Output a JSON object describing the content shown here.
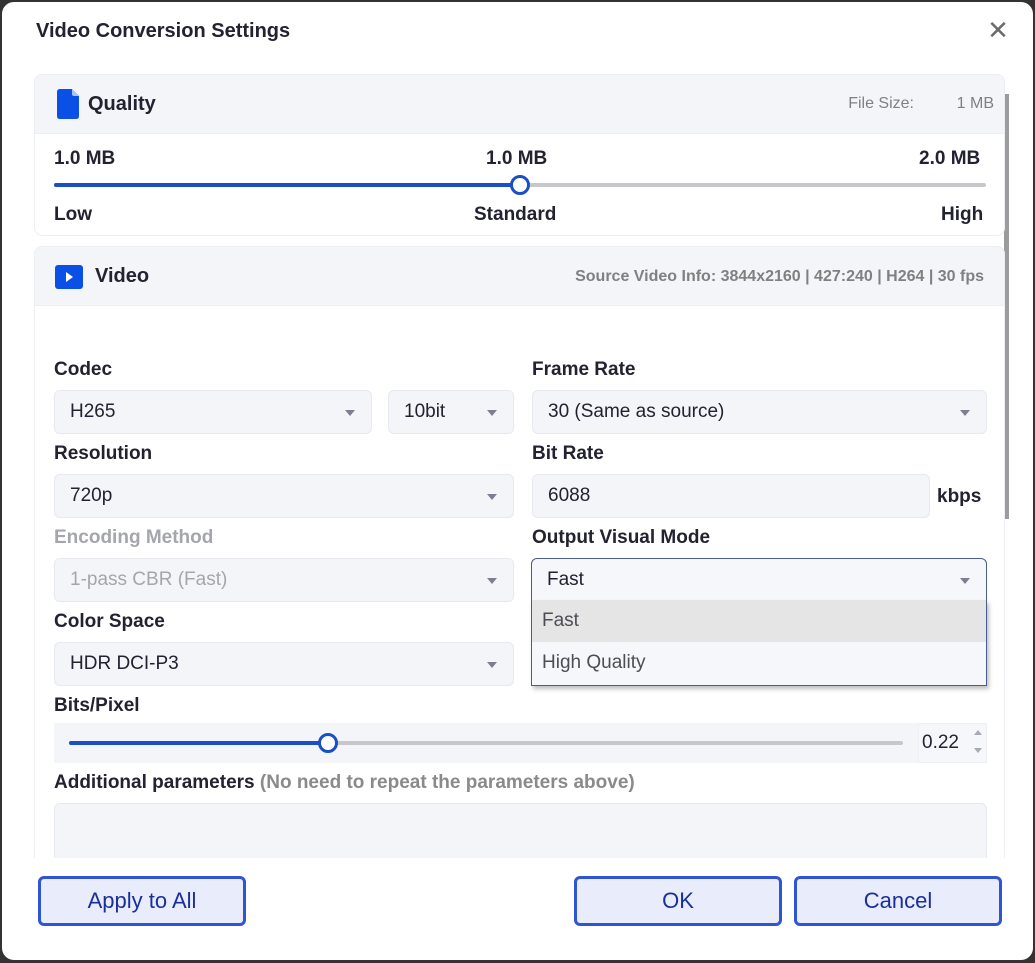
{
  "dialog": {
    "title": "Video Conversion Settings",
    "close_icon": "close-icon"
  },
  "quality": {
    "title": "Quality",
    "icon": "file-icon",
    "file_size_label": "File Size:",
    "file_size_value": "1 MB",
    "min_size": "1.0 MB",
    "mid_size": "1.0 MB",
    "max_size": "2.0 MB",
    "low_label": "Low",
    "standard_label": "Standard",
    "high_label": "High",
    "slider_value_fraction": 0.5
  },
  "video": {
    "title": "Video",
    "icon": "play-icon",
    "source_info": "Source Video Info: 3844x2160 | 427:240 | H264 | 30 fps",
    "codec_label": "Codec",
    "codec_value": "H265",
    "bit_depth_value": "10bit",
    "frame_rate_label": "Frame Rate",
    "frame_rate_value": "30 (Same as source)",
    "resolution_label": "Resolution",
    "resolution_value": "720p",
    "bit_rate_label": "Bit Rate",
    "bit_rate_value": "6088",
    "bit_rate_unit": "kbps",
    "encoding_label": "Encoding Method",
    "encoding_value": "1-pass CBR (Fast)",
    "output_mode_label": "Output Visual Mode",
    "output_mode_value": "Fast",
    "output_mode_options": [
      "Fast",
      "High Quality"
    ],
    "color_space_label": "Color Space",
    "color_space_value": "HDR DCI-P3",
    "bpp_label": "Bits/Pixel",
    "bpp_value": "0.22",
    "bpp_slider_fraction": 0.31,
    "additional_label": "Additional parameters",
    "additional_hint": "(No need to repeat the parameters above)",
    "additional_value": ""
  },
  "footer": {
    "apply_all": "Apply to All",
    "ok": "OK",
    "cancel": "Cancel"
  },
  "colors": {
    "accent": "#1a4fc8",
    "button_border": "#2f55d4",
    "button_text": "#1b2f9c",
    "button_bg": "#e8ecfb"
  }
}
